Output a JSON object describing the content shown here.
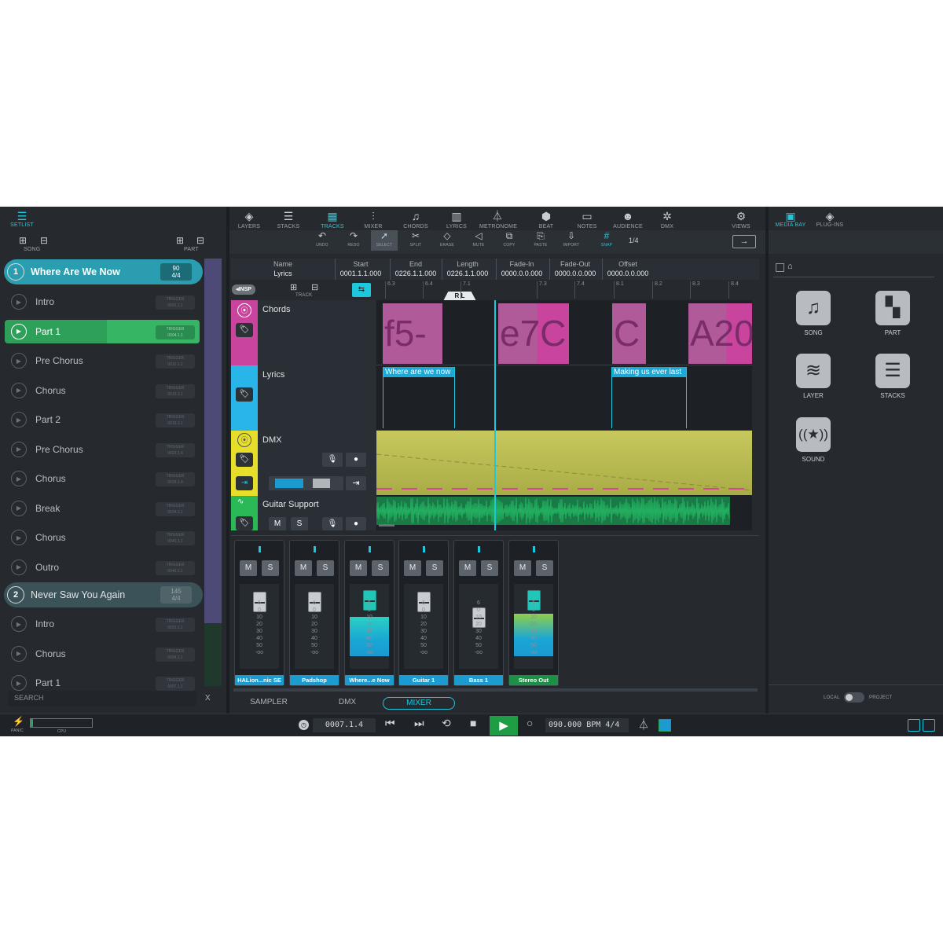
{
  "colors": {
    "accent": "#1ec8dc",
    "song_active": "#2b9db0",
    "part_active": "#2fa05a",
    "chord": "#b05a9a",
    "lyric": "#1ea8d6",
    "dmx": "#b8bb4d",
    "audio": "#1f9a57",
    "fader_blue": "#1b9bd0"
  },
  "setlist": {
    "title": "SETLIST",
    "song_label": "SONG",
    "part_label": "PART",
    "songs": [
      {
        "num": "1",
        "name": "Where Are We Now",
        "tempo": "90",
        "sig": "4/4"
      },
      {
        "num": "2",
        "name": "Never Saw You Again",
        "tempo": "145",
        "sig": "4/4"
      }
    ],
    "parts": [
      {
        "name": "Intro",
        "trigger": "TRIGGER",
        "pos": "0001.1.1"
      },
      {
        "name": "Part 1",
        "trigger": "TRIGGER",
        "pos": "0004.1.1"
      },
      {
        "name": "Pre Chorus",
        "trigger": "TRIGGER",
        "pos": "0010.1.1"
      },
      {
        "name": "Chorus",
        "trigger": "TRIGGER",
        "pos": "0013.1.1"
      },
      {
        "name": "Part 2",
        "trigger": "TRIGGER",
        "pos": "0019.1.1"
      },
      {
        "name": "Pre Chorus",
        "trigger": "TRIGGER",
        "pos": "0023.1.4"
      },
      {
        "name": "Chorus",
        "trigger": "TRIGGER",
        "pos": "0028.1.4"
      },
      {
        "name": "Break",
        "trigger": "TRIGGER",
        "pos": "0034.1.1"
      },
      {
        "name": "Chorus",
        "trigger": "TRIGGER",
        "pos": "0040.1.1"
      },
      {
        "name": "Outro",
        "trigger": "TRIGGER",
        "pos": "0046.1.1"
      },
      {
        "name": "Intro",
        "trigger": "TRIGGER",
        "pos": "0001.1.1"
      },
      {
        "name": "Chorus",
        "trigger": "TRIGGER",
        "pos": "0004.1.1"
      },
      {
        "name": "Part 1",
        "trigger": "TRIGGER",
        "pos": "0007.1.1"
      }
    ],
    "search_placeholder": "SEARCH",
    "search_clear": "X"
  },
  "toolbar": {
    "tabs": [
      {
        "label": "LAYERS",
        "icon": "layers-icon"
      },
      {
        "label": "STACKS",
        "icon": "stacks-icon"
      },
      {
        "label": "TRACKS",
        "icon": "tracks-icon"
      },
      {
        "label": "MIXER",
        "icon": "mixer-icon"
      },
      {
        "label": "CHORDS",
        "icon": "chords-icon"
      },
      {
        "label": "LYRICS",
        "icon": "lyrics-icon"
      },
      {
        "label": "METRONOME",
        "icon": "metronome-icon"
      },
      {
        "label": "BEAT",
        "icon": "beat-icon"
      },
      {
        "label": "NOTES",
        "icon": "notes-icon"
      },
      {
        "label": "AUDIENCE",
        "icon": "audience-icon"
      },
      {
        "label": "DMX",
        "icon": "dmx-icon"
      },
      {
        "label": "VIEWS",
        "icon": "views-icon"
      }
    ],
    "tools": [
      "UNDO",
      "REDO",
      "SELECT",
      "SPLIT",
      "ERASE",
      "MUTE",
      "COPY",
      "PASTE",
      "IMPORT",
      "SNAP"
    ],
    "snap_value": "1/4"
  },
  "info": {
    "headers": [
      "Name",
      "Start",
      "End",
      "Length",
      "Fade-In",
      "Fade-Out",
      "Offset"
    ],
    "values": [
      "Lyrics",
      "0001.1.1.000",
      "0226.1.1.000",
      "0226.1.1.000",
      "0000.0.0.000",
      "0000.0.0.000",
      "0000.0.0.000"
    ]
  },
  "ruler": {
    "insp": "INSP",
    "track": "TRACK",
    "ticks": [
      "6.3",
      "6.4",
      "7.1",
      "7.3",
      "7.4",
      "8.1",
      "8.2",
      "8.3",
      "8.4"
    ],
    "locator_r": "R",
    "locator_l": "L"
  },
  "tracks": {
    "chords": {
      "name": "Chords",
      "clips": [
        "f5-",
        "e7C",
        "C",
        "A20"
      ]
    },
    "lyrics": {
      "name": "Lyrics",
      "clips": [
        "Where are we now",
        "Making us ever last"
      ]
    },
    "dmx": {
      "name": "DMX"
    },
    "guitar": {
      "name": "Guitar Support",
      "mute": "M",
      "solo": "S"
    }
  },
  "mixer": {
    "strips": [
      {
        "name": "HALion...nic SE",
        "m": "M",
        "s": "S",
        "level": 0.0
      },
      {
        "name": "Padshop",
        "m": "M",
        "s": "S",
        "level": 0.0
      },
      {
        "name": "Where...e Now",
        "m": "M",
        "s": "S",
        "level": 0.62
      },
      {
        "name": "Guitar 1",
        "m": "M",
        "s": "S",
        "level": 0.0
      },
      {
        "name": "Bass 1",
        "m": "M",
        "s": "S",
        "level": 0.0
      },
      {
        "name": "Stereo Out",
        "m": "M",
        "s": "S",
        "level": 0.68
      }
    ],
    "scale": [
      "6",
      "0",
      "10",
      "20",
      "30",
      "40",
      "50",
      "-oo"
    ],
    "tabs": [
      "SAMPLER",
      "DMX",
      "MIXER"
    ]
  },
  "mediabay": {
    "tabs": [
      "MEDIA BAY",
      "PLUG-INS"
    ],
    "items": [
      {
        "label": "SONG",
        "icon": "music-note-icon"
      },
      {
        "label": "PART",
        "icon": "part-icon"
      },
      {
        "label": "LAYER",
        "icon": "layer-icon"
      },
      {
        "label": "STACKS",
        "icon": "stacks-icon"
      },
      {
        "label": "SOUND",
        "icon": "sound-icon"
      }
    ],
    "local": "LOCAL",
    "project": "PROJECT"
  },
  "transport": {
    "panic": "PANIC",
    "cpu": "CPU",
    "position": "0007.1.4",
    "tempo": "090.000",
    "bpm": "BPM",
    "sig": "4/4"
  }
}
